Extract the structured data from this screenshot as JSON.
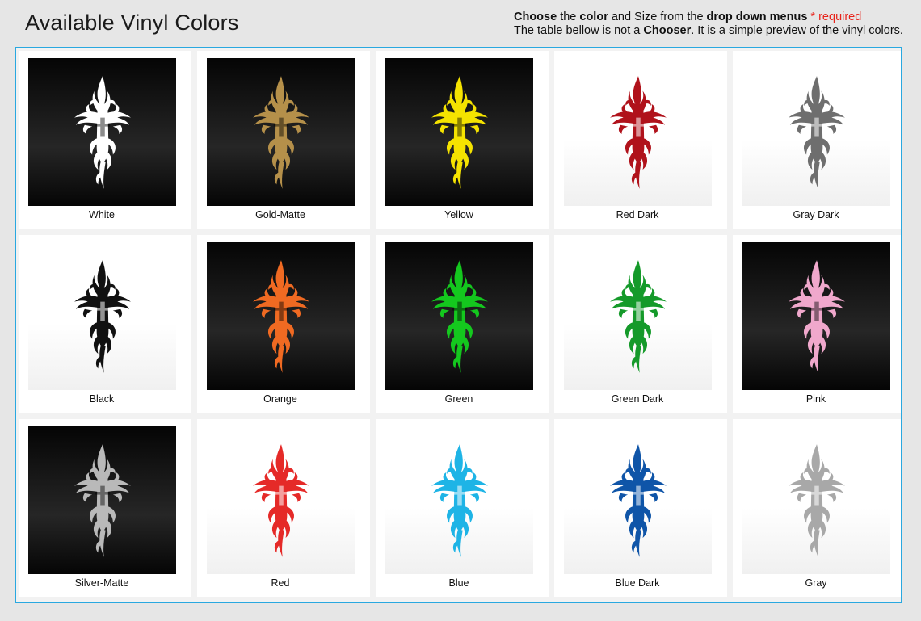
{
  "header": {
    "title": "Available Vinyl Colors",
    "line1": {
      "w1": "Choose",
      "t1": " the ",
      "w2": "color",
      "t2": " and Size from the ",
      "w3": "drop down menus",
      "req": " * required"
    },
    "line2": {
      "t1": "The table bellow is not a ",
      "w1": "Chooser",
      "t2": ". It is a simple preview of the vinyl colors."
    }
  },
  "colors": [
    {
      "label": "White",
      "color": "#ffffff",
      "bg": "dark"
    },
    {
      "label": "Gold-Matte",
      "color": "#b5904a",
      "bg": "dark"
    },
    {
      "label": "Yellow",
      "color": "#f5e300",
      "bg": "dark"
    },
    {
      "label": "Red Dark",
      "color": "#b0121b",
      "bg": "light"
    },
    {
      "label": "Gray Dark",
      "color": "#6e6e6e",
      "bg": "light"
    },
    {
      "label": "Black",
      "color": "#111111",
      "bg": "light"
    },
    {
      "label": "Orange",
      "color": "#f06a22",
      "bg": "dark"
    },
    {
      "label": "Green",
      "color": "#14c81e",
      "bg": "dark"
    },
    {
      "label": "Green Dark",
      "color": "#159a2a",
      "bg": "light"
    },
    {
      "label": "Pink",
      "color": "#f0a8cc",
      "bg": "dark"
    },
    {
      "label": "Silver-Matte",
      "color": "#b9b9b9",
      "bg": "dark"
    },
    {
      "label": "Red",
      "color": "#e52a28",
      "bg": "light"
    },
    {
      "label": "Blue",
      "color": "#1eb4e6",
      "bg": "light"
    },
    {
      "label": "Blue Dark",
      "color": "#0f55a8",
      "bg": "light"
    },
    {
      "label": "Gray",
      "color": "#a8a8a8",
      "bg": "light"
    }
  ]
}
